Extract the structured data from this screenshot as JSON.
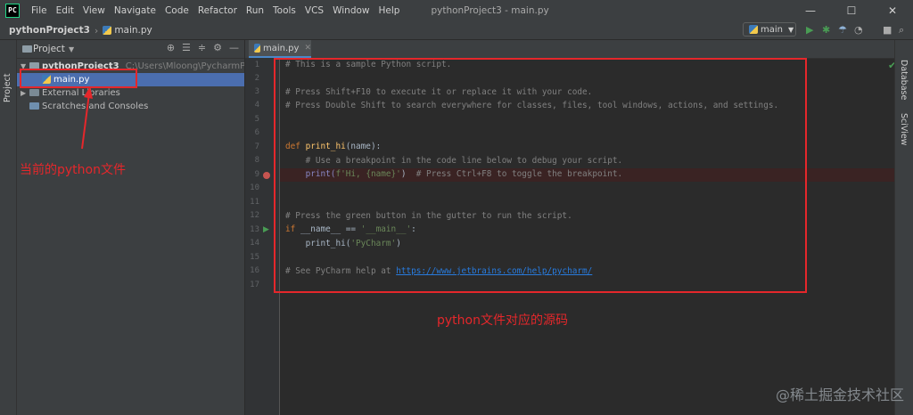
{
  "window": {
    "title": "pythonProject3 - main.py",
    "menu": [
      "File",
      "Edit",
      "View",
      "Navigate",
      "Code",
      "Refactor",
      "Run",
      "Tools",
      "VCS",
      "Window",
      "Help"
    ],
    "controls": {
      "minimize": "—",
      "maximize": "☐",
      "close": "✕"
    }
  },
  "breadcrumb": {
    "project": "pythonProject3",
    "file": "main.py"
  },
  "toolbar": {
    "run_config": "main"
  },
  "left_strip": {
    "project_label": "Project"
  },
  "right_strip": {
    "database_label": "Database",
    "sciview_label": "SciView"
  },
  "project_panel": {
    "title": "Project",
    "tree": [
      {
        "label": "pythonProject3",
        "path": "C:\\Users\\Mloong\\PycharmProjects\\"
      },
      {
        "label": "main.py"
      },
      {
        "label": "External Libraries"
      },
      {
        "label": "Scratches and Consoles"
      }
    ]
  },
  "editor": {
    "tab_label": "main.py",
    "line_numbers": [
      "1",
      "2",
      "3",
      "4",
      "5",
      "6",
      "7",
      "8",
      "9",
      "10",
      "11",
      "12",
      "13",
      "14",
      "15",
      "16",
      "17"
    ],
    "lines": {
      "l1": "# This is a sample Python script.",
      "l3": "# Press Shift+F10 to execute it or replace it with your code.",
      "l4": "# Press Double Shift to search everywhere for classes, files, tool windows, actions, and settings.",
      "l7_def": "def ",
      "l7_fn": "print_hi",
      "l7_rest": "(name):",
      "l8": "    # Use a breakpoint in the code line below to debug your script.",
      "l9_a": "    print(",
      "l9_b": "f'Hi, {name}'",
      "l9_c": ")  ",
      "l9_d": "# Press Ctrl+F8 to toggle the breakpoint.",
      "l12": "# Press the green button in the gutter to run the script.",
      "l13_kw": "if ",
      "l13_a": "__name__ == ",
      "l13_b": "'__main__'",
      "l13_c": ":",
      "l14_a": "    print_hi(",
      "l14_b": "'PyCharm'",
      "l14_c": ")",
      "l16_a": "# See PyCharm help at ",
      "l16_link": "https://www.jetbrains.com/help/pycharm/"
    }
  },
  "annotations": {
    "current_file": "当前的python文件",
    "source_code": "python文件对应的源码"
  },
  "watermark": "@稀土掘金技术社区",
  "colors": {
    "accent": "#4b6eaf",
    "annotation_red": "#e5272b",
    "run_green": "#499c54"
  }
}
